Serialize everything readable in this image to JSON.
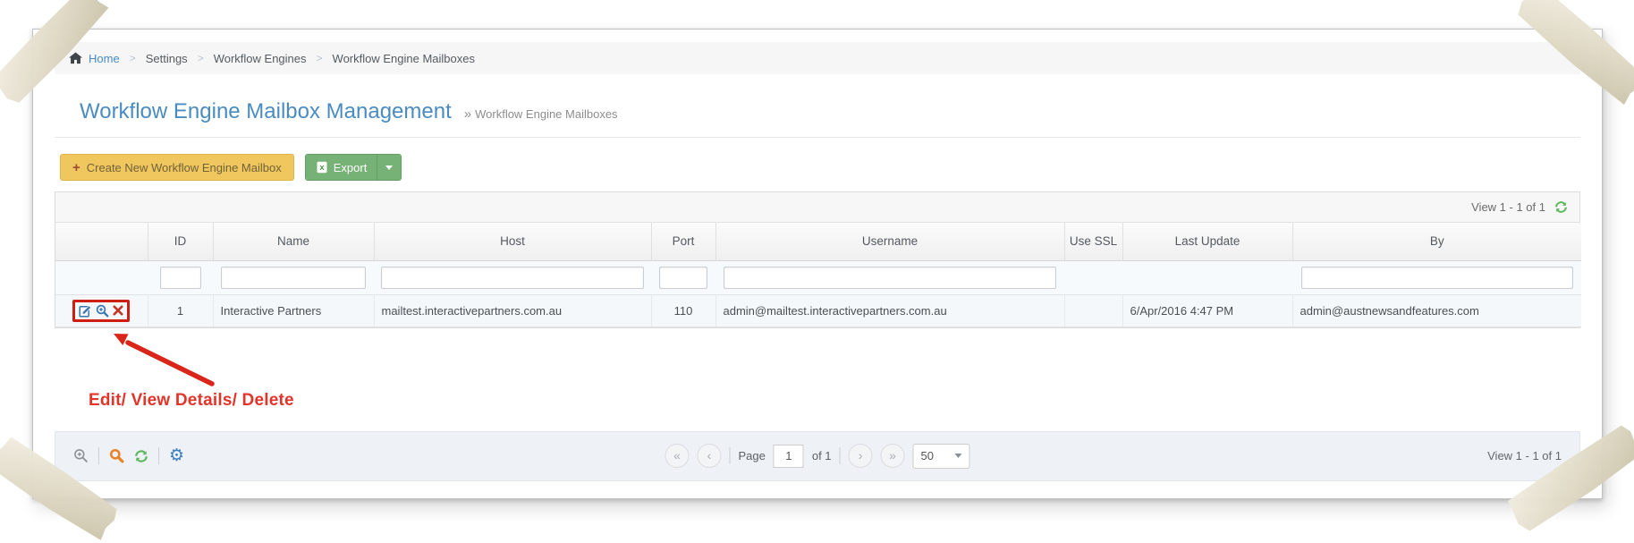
{
  "breadcrumb": {
    "home": "Home",
    "separator": ">",
    "items": [
      "Settings",
      "Workflow Engines",
      "Workflow Engine Mailboxes"
    ]
  },
  "page": {
    "title": "Workflow Engine Mailbox Management",
    "subtitle_marker": "»",
    "subtitle": "Workflow Engine Mailboxes"
  },
  "icons": {
    "plus": "+",
    "gear": "⚙"
  },
  "toolbar": {
    "create_label": "Create New Workflow Engine Mailbox",
    "export_label": "Export"
  },
  "grid": {
    "view_count": "View 1 - 1 of 1",
    "columns": [
      "",
      "ID",
      "Name",
      "Host",
      "Port",
      "Username",
      "Use SSL",
      "Last Update",
      "By"
    ],
    "filters": {
      "id": "",
      "name": "",
      "host": "",
      "port": "",
      "username": "",
      "by": ""
    },
    "row": {
      "id": "1",
      "name": "Interactive Partners",
      "host": "mailtest.interactivepartners.com.au",
      "port": "110",
      "username": "admin@mailtest.interactivepartners.com.au",
      "use_ssl": "",
      "last_update": "6/Apr/2016 4:47 PM",
      "by": "admin@austnewsandfeatures.com"
    }
  },
  "annotation": {
    "label": "Edit/ View Details/ Delete"
  },
  "pager": {
    "first": "«",
    "prev": "‹",
    "next": "›",
    "last": "»",
    "page_label": "Page",
    "page_value": "1",
    "of_label": "of 1",
    "page_size": "50",
    "view_count": "View 1 - 1 of 1"
  },
  "colors": {
    "title_blue": "#4a8bc2",
    "create_yellow": "#efc75e",
    "export_green": "#76b276",
    "annotation_red": "#d9251a",
    "refresh_green": "#5cb85c"
  }
}
